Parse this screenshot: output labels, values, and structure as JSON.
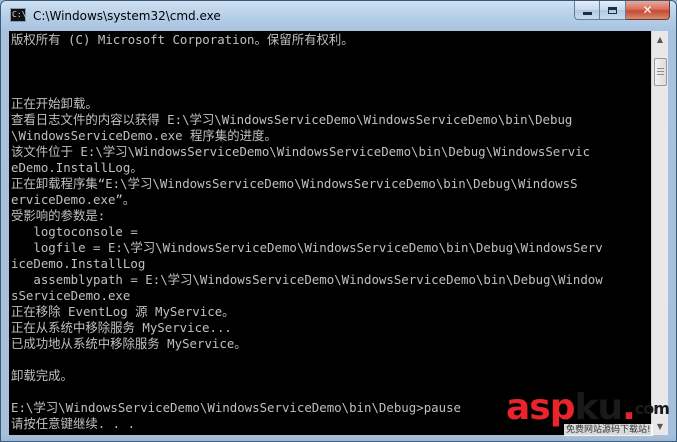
{
  "window": {
    "title": "C:\\Windows\\system32\\cmd.exe",
    "icon_glyph": "C:\\"
  },
  "caption_buttons": {
    "close_glyph": "✕"
  },
  "console": {
    "lines": [
      "版权所有 (C) Microsoft Corporation。保留所有权利。",
      "",
      "",
      "",
      "正在开始卸载。",
      "查看日志文件的内容以获得 E:\\学习\\WindowsServiceDemo\\WindowsServiceDemo\\bin\\Debug",
      "\\WindowsServiceDemo.exe 程序集的进度。",
      "该文件位于 E:\\学习\\WindowsServiceDemo\\WindowsServiceDemo\\bin\\Debug\\WindowsServic",
      "eDemo.InstallLog。",
      "正在卸载程序集“E:\\学习\\WindowsServiceDemo\\WindowsServiceDemo\\bin\\Debug\\WindowsS",
      "erviceDemo.exe”。",
      "受影响的参数是:",
      "   logtoconsole =",
      "   logfile = E:\\学习\\WindowsServiceDemo\\WindowsServiceDemo\\bin\\Debug\\WindowsServ",
      "iceDemo.InstallLog",
      "   assemblypath = E:\\学习\\WindowsServiceDemo\\WindowsServiceDemo\\bin\\Debug\\Window",
      "sServiceDemo.exe",
      "正在移除 EventLog 源 MyService。",
      "正在从系统中移除服务 MyService...",
      "已成功地从系统中移除服务 MyService。",
      "",
      "卸载完成。",
      "",
      "E:\\学习\\WindowsServiceDemo\\WindowsServiceDemo\\bin\\Debug>pause",
      "请按任意键继续. . ."
    ]
  },
  "watermark": {
    "logo_asp": "asp",
    "logo_ku": "ku",
    "logo_dot": ".",
    "logo_com": "com",
    "subtitle": "免费网站源码下载站!"
  }
}
